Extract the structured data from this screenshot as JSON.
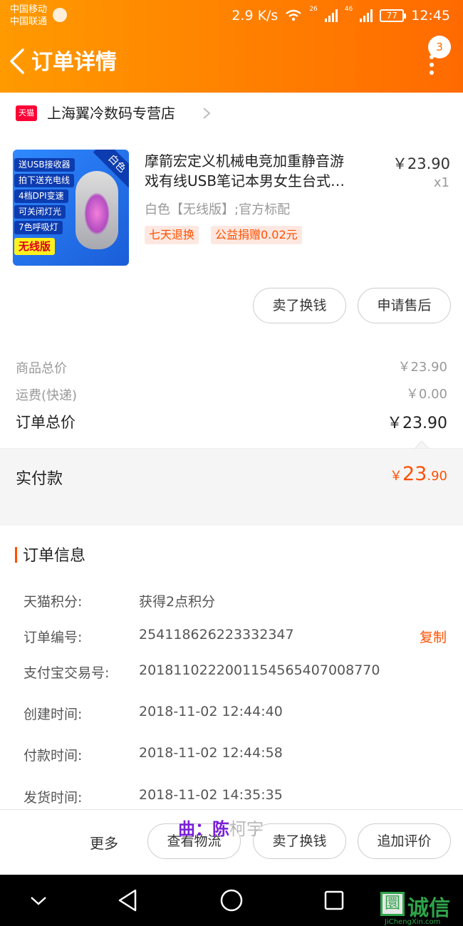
{
  "status_bar": {
    "carrier_1": "中国移动",
    "carrier_2": "中国联通",
    "speed": "2.9 K/s",
    "net_1": "26",
    "net_2": "46",
    "battery": "77",
    "time": "12:45"
  },
  "header": {
    "title": "订单详情",
    "badge_count": "3"
  },
  "store": {
    "badge": "天猫",
    "name": "上海翼冷数码专营店"
  },
  "product": {
    "image_tags": [
      "送USB接收器",
      "拍下送充电线",
      "4档DPI变速",
      "可关闭灯光",
      "7色呼吸灯"
    ],
    "image_highlight": "无线版",
    "image_corner": "白色",
    "title_line_1": "摩箭宏定义机械电竞加重静音游",
    "title_line_2": "戏有线USB笔记本男女生台式…",
    "price": "￥23.90",
    "qty": "x1",
    "sku": "白色【无线版】;官方标配",
    "service_tags": [
      "七天退换",
      "公益捐赠0.02元"
    ]
  },
  "item_actions": {
    "sell": "卖了换钱",
    "after_sale": "申请售后"
  },
  "fees": {
    "goods_total_label": "商品总价",
    "goods_total_value": "￥23.90",
    "shipping_label": "运费(快递)",
    "shipping_value": "￥0.00",
    "order_total_label": "订单总价",
    "order_total_value": "￥23.90"
  },
  "paid": {
    "label": "实付款",
    "currency": "￥",
    "integer": "23",
    "decimal": ".90"
  },
  "order_info": {
    "title": "订单信息",
    "rows": [
      {
        "key": "天猫积分:",
        "value": "获得2点积分"
      },
      {
        "key": "订单编号:",
        "value": "254118626223332347"
      },
      {
        "key": "支付宝交易号:",
        "value": "2018110222001154565407008770"
      },
      {
        "key": "创建时间:",
        "value": "2018-11-02 12:44:40"
      },
      {
        "key": "付款时间:",
        "value": "2018-11-02 12:44:58"
      },
      {
        "key": "发货时间:",
        "value": "2018-11-02 14:35:35"
      }
    ],
    "copy_label": "复制"
  },
  "bottom_bar": {
    "more": "更多",
    "logistics": "查看物流",
    "sell": "卖了换钱",
    "review": "追加评价"
  },
  "watermark": {
    "strong": "曲：陈",
    "faint": "柯宇"
  },
  "site_logo": {
    "glyph": "圜",
    "text": "诚信",
    "url_text": "JiChengXin.com"
  },
  "colors": {
    "accent": "#ff5000",
    "header_start": "#ff9a00",
    "header_end": "#ff6a00"
  }
}
